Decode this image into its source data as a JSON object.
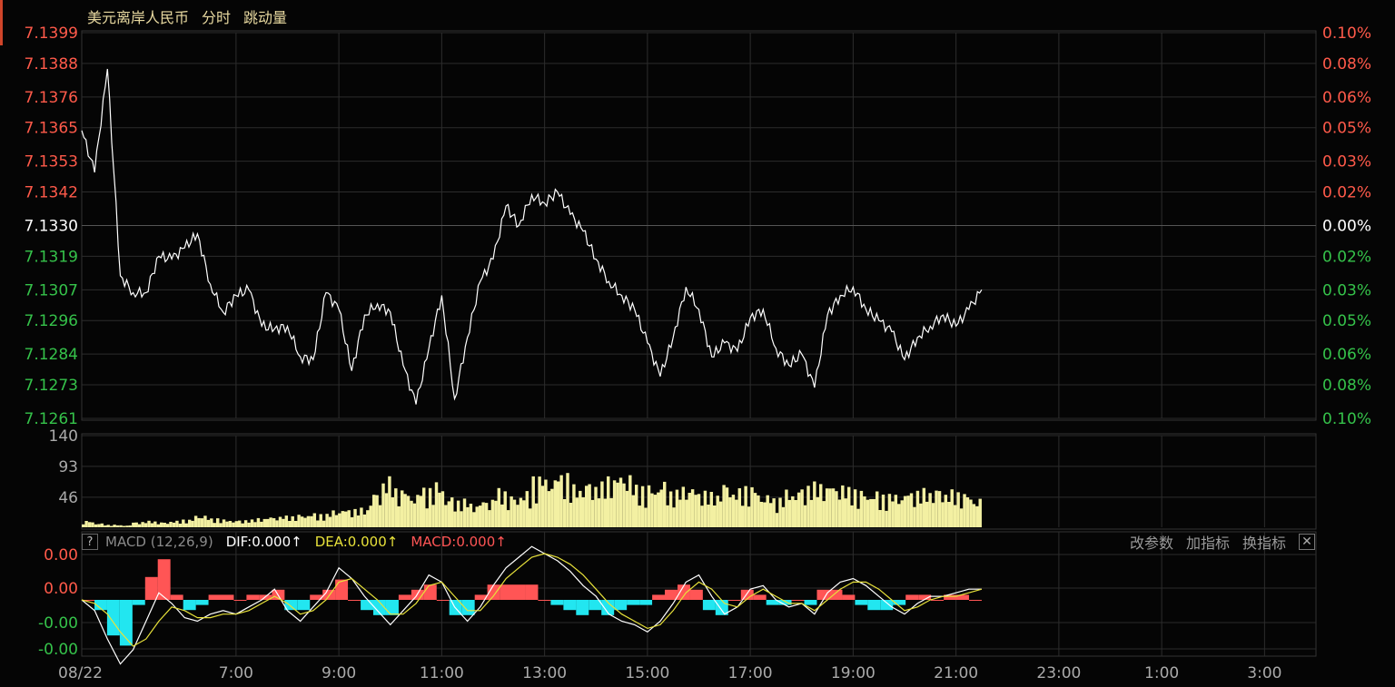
{
  "title": {
    "instrument": "美元离岸人民币",
    "mode": "分时",
    "tick": "跳动量"
  },
  "macd": {
    "help": "?",
    "label": "MACD (12,26,9)",
    "dif": "DIF:0.000↑",
    "dea": "DEA:0.000↑",
    "macd": "MACD:0.000↑",
    "actions": [
      "改参数",
      "加指标",
      "换指标"
    ],
    "close": "✕"
  },
  "colors": {
    "up": "#ff5a4a",
    "down": "#35c24a",
    "neutral": "#ffffff",
    "volume": "#f3f0a2",
    "dif": "#ffffff",
    "dea": "#e8e23a",
    "macd_pos": "#ff5555",
    "macd_neg": "#22e6f0",
    "grid": "#2c2c2c",
    "accent": "#d0452a"
  },
  "chart_data": [
    {
      "type": "line",
      "name": "price",
      "y_ticks": [
        "7.1399",
        "7.1388",
        "7.1376",
        "7.1365",
        "7.1353",
        "7.1342",
        "7.1330",
        "7.1319",
        "7.1307",
        "7.1296",
        "7.1284",
        "7.1273",
        "7.1261"
      ],
      "pct_ticks": [
        "0.10%",
        "0.08%",
        "0.06%",
        "0.05%",
        "0.03%",
        "0.02%",
        "0.00%",
        "0.02%",
        "0.03%",
        "0.05%",
        "0.06%",
        "0.08%",
        "0.10%"
      ],
      "ylim": [
        7.1261,
        7.1399
      ],
      "prev_close": 7.133,
      "x_start": "04:00",
      "x_end": "04:00",
      "x_ticks": [
        "08/22",
        "7:00",
        "9:00",
        "11:00",
        "13:00",
        "15:00",
        "17:00",
        "19:00",
        "21:00",
        "23:00",
        "1:00",
        "3:00"
      ],
      "points": [
        [
          "04:00",
          7.1364
        ],
        [
          "04:15",
          7.1349
        ],
        [
          "04:30",
          7.1386
        ],
        [
          "04:45",
          7.1312
        ],
        [
          "05:00",
          7.1306
        ],
        [
          "05:15",
          7.1306
        ],
        [
          "05:30",
          7.1319
        ],
        [
          "05:45",
          7.1318
        ],
        [
          "06:00",
          7.1322
        ],
        [
          "06:15",
          7.1327
        ],
        [
          "06:30",
          7.1309
        ],
        [
          "06:45",
          7.1299
        ],
        [
          "07:00",
          7.1305
        ],
        [
          "07:15",
          7.1307
        ],
        [
          "07:30",
          7.1294
        ],
        [
          "07:45",
          7.1293
        ],
        [
          "08:00",
          7.1294
        ],
        [
          "08:15",
          7.1283
        ],
        [
          "08:30",
          7.1282
        ],
        [
          "08:45",
          7.1306
        ],
        [
          "09:00",
          7.13
        ],
        [
          "09:15",
          7.1278
        ],
        [
          "09:30",
          7.1298
        ],
        [
          "09:45",
          7.1302
        ],
        [
          "10:00",
          7.1299
        ],
        [
          "10:15",
          7.128
        ],
        [
          "10:30",
          7.1266
        ],
        [
          "10:45",
          7.1286
        ],
        [
          "11:00",
          7.1305
        ],
        [
          "11:15",
          7.1268
        ],
        [
          "11:30",
          7.129
        ],
        [
          "11:45",
          7.131
        ],
        [
          "12:00",
          7.1318
        ],
        [
          "12:15",
          7.1337
        ],
        [
          "12:30",
          7.133
        ],
        [
          "12:45",
          7.1341
        ],
        [
          "13:00",
          7.1338
        ],
        [
          "13:15",
          7.1342
        ],
        [
          "13:30",
          7.1334
        ],
        [
          "13:45",
          7.1328
        ],
        [
          "14:00",
          7.1318
        ],
        [
          "14:15",
          7.131
        ],
        [
          "14:30",
          7.1305
        ],
        [
          "14:45",
          7.13
        ],
        [
          "15:00",
          7.1288
        ],
        [
          "15:15",
          7.1276
        ],
        [
          "15:30",
          7.129
        ],
        [
          "15:45",
          7.1308
        ],
        [
          "16:00",
          7.13
        ],
        [
          "16:15",
          7.1283
        ],
        [
          "16:30",
          7.1288
        ],
        [
          "16:45",
          7.1285
        ],
        [
          "17:00",
          7.1297
        ],
        [
          "17:15",
          7.13
        ],
        [
          "17:30",
          7.1286
        ],
        [
          "17:45",
          7.128
        ],
        [
          "18:00",
          7.1284
        ],
        [
          "18:15",
          7.1272
        ],
        [
          "18:30",
          7.1298
        ],
        [
          "18:45",
          7.1305
        ],
        [
          "19:00",
          7.1308
        ],
        [
          "19:15",
          7.13
        ],
        [
          "19:30",
          7.1296
        ],
        [
          "19:45",
          7.1292
        ],
        [
          "20:00",
          7.1282
        ],
        [
          "20:15",
          7.129
        ],
        [
          "20:30",
          7.1294
        ],
        [
          "20:45",
          7.1298
        ],
        [
          "21:00",
          7.1294
        ],
        [
          "21:15",
          7.13
        ],
        [
          "21:30",
          7.1307
        ]
      ]
    },
    {
      "type": "bar",
      "name": "volume",
      "y_ticks": [
        "140",
        "93",
        "46"
      ],
      "ylim": [
        0,
        140
      ],
      "values": [
        10,
        6,
        4,
        3,
        8,
        10,
        8,
        10,
        12,
        18,
        14,
        12,
        11,
        12,
        14,
        16,
        18,
        20,
        22,
        21,
        26,
        28,
        30,
        55,
        78,
        60,
        50,
        62,
        70,
        48,
        44,
        36,
        42,
        60,
        50,
        56,
        80,
        74,
        84,
        66,
        72,
        70,
        78,
        80,
        66,
        66,
        72,
        58,
        62,
        56,
        54,
        70,
        60,
        64,
        50,
        46,
        58,
        62,
        70,
        66,
        64,
        62,
        58,
        56,
        52,
        50,
        56,
        60,
        62,
        58,
        54,
        44
      ]
    },
    {
      "type": "line",
      "name": "macd",
      "y_ticks": [
        "0.00",
        "0.00",
        "-0.00",
        "-0.00"
      ],
      "series": [
        {
          "name": "DIF",
          "values": [
            0.0,
            -0.3,
            -1.1,
            -1.8,
            -1.4,
            -0.6,
            0.2,
            -0.1,
            -0.5,
            -0.6,
            -0.4,
            -0.3,
            -0.4,
            -0.2,
            0.0,
            0.3,
            -0.3,
            -0.6,
            -0.2,
            0.2,
            0.9,
            0.6,
            0.1,
            -0.3,
            -0.7,
            -0.3,
            0.1,
            0.7,
            0.5,
            -0.2,
            -0.6,
            -0.2,
            0.4,
            0.9,
            1.2,
            1.5,
            1.3,
            1.1,
            0.8,
            0.4,
            0.1,
            -0.4,
            -0.6,
            -0.7,
            -0.9,
            -0.6,
            -0.1,
            0.5,
            0.7,
            0.1,
            -0.4,
            -0.2,
            0.3,
            0.4,
            0.0,
            -0.2,
            -0.1,
            -0.4,
            0.2,
            0.5,
            0.6,
            0.4,
            0.1,
            -0.2,
            -0.4,
            -0.1,
            0.1,
            0.1,
            0.2,
            0.3,
            0.3
          ]
        },
        {
          "name": "DEA",
          "values": [
            0.0,
            -0.1,
            -0.4,
            -0.9,
            -1.3,
            -1.1,
            -0.6,
            -0.2,
            -0.3,
            -0.5,
            -0.5,
            -0.4,
            -0.4,
            -0.3,
            -0.1,
            0.1,
            -0.1,
            -0.4,
            -0.3,
            0.0,
            0.5,
            0.6,
            0.3,
            0.0,
            -0.4,
            -0.4,
            -0.1,
            0.4,
            0.5,
            0.1,
            -0.3,
            -0.3,
            0.1,
            0.6,
            0.9,
            1.2,
            1.3,
            1.2,
            1.0,
            0.7,
            0.3,
            -0.1,
            -0.4,
            -0.6,
            -0.8,
            -0.7,
            -0.3,
            0.2,
            0.5,
            0.3,
            -0.1,
            -0.2,
            0.1,
            0.3,
            0.1,
            -0.1,
            -0.1,
            -0.3,
            0.0,
            0.3,
            0.5,
            0.5,
            0.3,
            0.0,
            -0.3,
            -0.2,
            0.0,
            0.1,
            0.1,
            0.2,
            0.3
          ]
        }
      ],
      "bars": [
        0.0,
        -0.4,
        -1.4,
        -1.8,
        -0.2,
        0.9,
        1.6,
        0.2,
        -0.4,
        -0.2,
        0.2,
        0.2,
        0.0,
        0.2,
        0.2,
        0.4,
        -0.4,
        -0.4,
        0.2,
        0.4,
        0.8,
        0.0,
        -0.4,
        -0.6,
        -0.6,
        0.2,
        0.4,
        0.6,
        0.0,
        -0.6,
        -0.6,
        0.2,
        0.6,
        0.6,
        0.6,
        0.6,
        0.0,
        -0.2,
        -0.4,
        -0.6,
        -0.4,
        -0.6,
        -0.4,
        -0.2,
        -0.2,
        0.2,
        0.4,
        0.6,
        0.4,
        -0.4,
        -0.6,
        0.0,
        0.4,
        0.2,
        -0.2,
        -0.2,
        0.0,
        -0.2,
        0.4,
        0.4,
        0.2,
        -0.2,
        -0.4,
        -0.4,
        -0.2,
        0.2,
        0.2,
        0.0,
        0.2,
        0.2,
        0.0
      ],
      "ylim": [
        -2.0,
        2.0
      ]
    }
  ]
}
